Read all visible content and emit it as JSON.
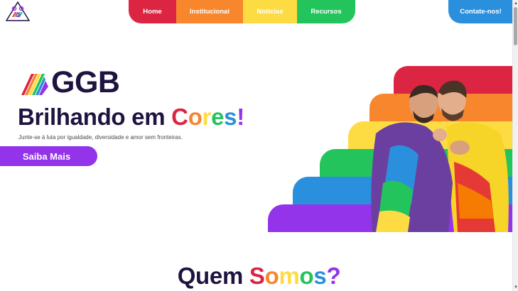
{
  "nav": {
    "items": [
      {
        "label": "Home",
        "color": "#dc2443"
      },
      {
        "label": "Institucional",
        "color": "#f7862d"
      },
      {
        "label": "Notícias",
        "color": "#fddc43"
      },
      {
        "label": "Recursos",
        "color": "#24c45d"
      }
    ],
    "contact_label": "Contate-nos!",
    "contact_color": "#2a8fdc"
  },
  "hero": {
    "brand": "GGB",
    "headline_prefix": "Brilhando em ",
    "headline_colored": [
      "C",
      "o",
      "r",
      "e",
      "s"
    ],
    "headline_suffix": "!",
    "subtitle": "Junte-se à luta por igualdade, diversidade e amor sem fronteiras.",
    "cta_label": "Saiba Mais"
  },
  "section": {
    "title_prefix": "Quem ",
    "title_colored": [
      "S",
      "o",
      "m",
      "o",
      "s"
    ],
    "title_suffix": "?"
  },
  "colors": {
    "red": "#dc2443",
    "orange": "#f7862d",
    "yellow": "#fddc43",
    "green": "#24c45d",
    "blue": "#2a8fdc",
    "purple": "#9333ea",
    "dark": "#1f1340"
  },
  "icons": [
    "logo-triangle-icon",
    "pride-triangle-icon",
    "scroll-up-icon",
    "scroll-down-icon"
  ]
}
